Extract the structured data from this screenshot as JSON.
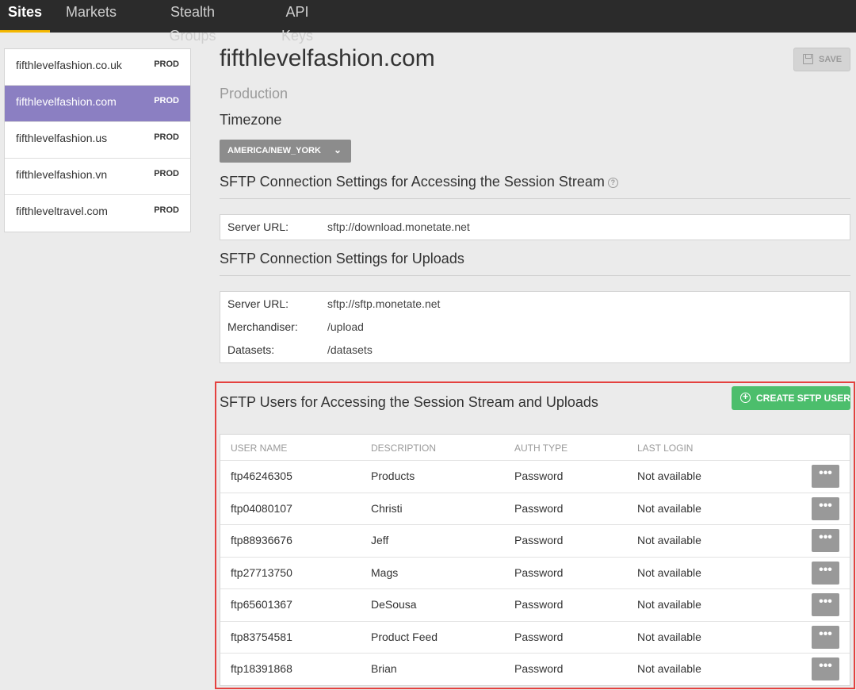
{
  "topnav": {
    "tabs": [
      {
        "label": "Sites"
      },
      {
        "label": "Markets"
      },
      {
        "label": "Stealth Groups"
      },
      {
        "label": "API Keys"
      }
    ]
  },
  "sites": [
    {
      "name": "fifthlevelfashion.co.uk",
      "env": "PROD"
    },
    {
      "name": "fifthlevelfashion.com",
      "env": "PROD"
    },
    {
      "name": "fifthlevelfashion.us",
      "env": "PROD"
    },
    {
      "name": "fifthlevelfashion.vn",
      "env": "PROD"
    },
    {
      "name": "fifthleveltravel.com",
      "env": "PROD"
    }
  ],
  "main": {
    "title": "fifthlevelfashion.com",
    "save_label": "SAVE",
    "environment": "Production",
    "timezone_heading": "Timezone",
    "timezone_value": "AMERICA/NEW_YORK",
    "session_heading": "SFTP Connection Settings for Accessing the Session Stream",
    "session_fields": [
      {
        "key": "Server URL:",
        "value": "sftp://download.monetate.net"
      }
    ],
    "uploads_heading": "SFTP Connection Settings for Uploads",
    "uploads_fields": [
      {
        "key": "Server URL:",
        "value": "sftp://sftp.monetate.net"
      },
      {
        "key": "Merchandiser:",
        "value": "/upload"
      },
      {
        "key": "Datasets:",
        "value": "/datasets"
      }
    ],
    "users_heading": "SFTP Users for Accessing the Session Stream and Uploads",
    "create_label": "CREATE SFTP USER",
    "users_columns": [
      "USER NAME",
      "DESCRIPTION",
      "AUTH TYPE",
      "LAST LOGIN"
    ],
    "more_label": "•••",
    "users": [
      {
        "username": "ftp46246305",
        "description": "Products",
        "auth": "Password",
        "last_login": "Not available"
      },
      {
        "username": "ftp04080107",
        "description": "Christi",
        "auth": "Password",
        "last_login": "Not available"
      },
      {
        "username": "ftp88936676",
        "description": "Jeff",
        "auth": "Password",
        "last_login": "Not available"
      },
      {
        "username": "ftp27713750",
        "description": "Mags",
        "auth": "Password",
        "last_login": "Not available"
      },
      {
        "username": "ftp65601367",
        "description": "DeSousa",
        "auth": "Password",
        "last_login": "Not available"
      },
      {
        "username": "ftp83754581",
        "description": "Product Feed",
        "auth": "Password",
        "last_login": "Not available"
      },
      {
        "username": "ftp18391868",
        "description": "Brian",
        "auth": "Password",
        "last_login": "Not available"
      }
    ]
  },
  "colors": {
    "accent_tab": "#f5b800",
    "active_site": "#8b7fc2",
    "create_button": "#4cbe6c",
    "highlight_outline": "#e4413f"
  }
}
